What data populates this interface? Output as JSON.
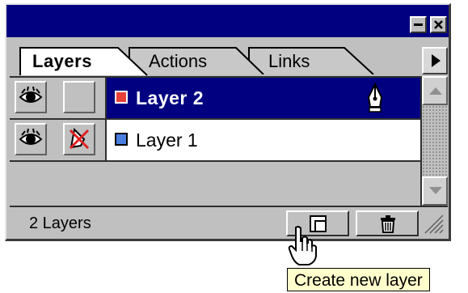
{
  "window": {
    "controls": {
      "minimize_icon": "minimize-icon",
      "close_icon": "close-icon"
    }
  },
  "tabs": [
    {
      "label": "Layers",
      "active": true
    },
    {
      "label": "Actions",
      "active": false
    },
    {
      "label": "Links",
      "active": false
    }
  ],
  "palette_menu_icon": "triangle-right-icon",
  "layers": [
    {
      "name": "Layer 2",
      "color": "#e8403a",
      "visible": true,
      "locked": false,
      "selected": true,
      "icon": "pen-nib-icon"
    },
    {
      "name": "Layer 1",
      "color": "#4a7fe0",
      "visible": true,
      "locked": false,
      "selected": false,
      "lock_icon": "no-edit-icon"
    }
  ],
  "footer": {
    "layer_count": "2 Layers",
    "new_layer_icon": "new-layer-icon",
    "delete_icon": "trash-icon"
  },
  "tooltip": {
    "text": "Create new layer"
  },
  "colors": {
    "title_bar": "#000080",
    "selection": "#000080",
    "panel": "#c0c0c0",
    "tooltip_bg": "#ffffcc"
  }
}
